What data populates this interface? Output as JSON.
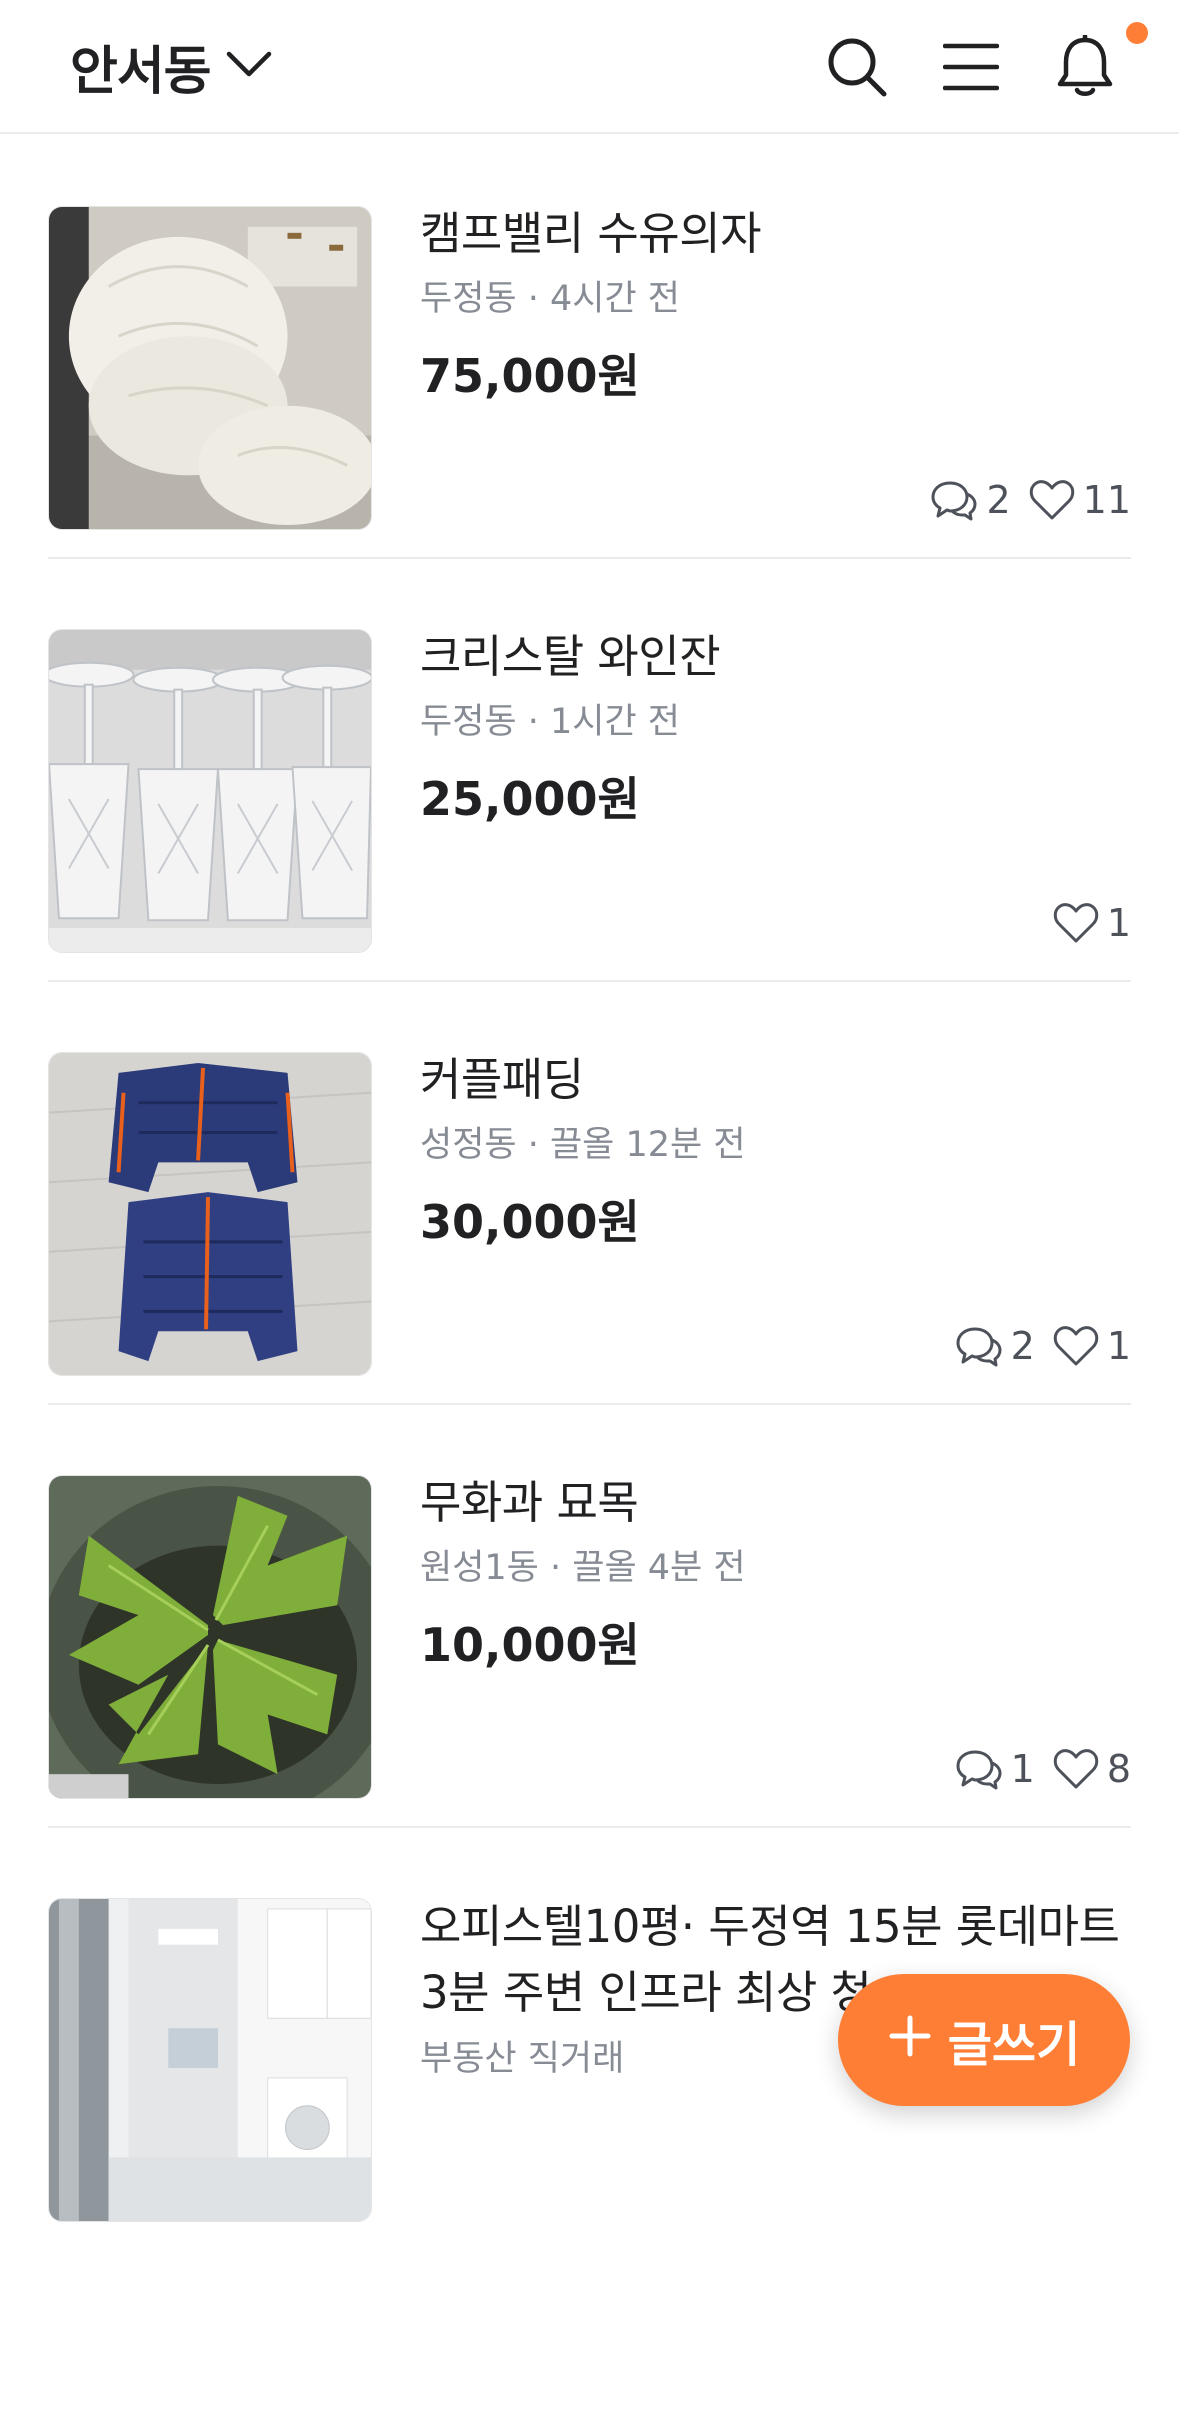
{
  "header": {
    "location": "안서동",
    "icons": [
      "search-icon",
      "menu-icon",
      "bell-icon"
    ],
    "notification_dot_color": "#ff7e36"
  },
  "items": [
    {
      "title": "캠프밸리 수유의자",
      "location": "두정동",
      "time": "4시간 전",
      "meta": "두정동 · 4시간 전",
      "price": "75,000원",
      "chats": "2",
      "likes": "11"
    },
    {
      "title": "크리스탈 와인잔",
      "location": "두정동",
      "time": "1시간 전",
      "meta": "두정동 · 1시간 전",
      "price": "25,000원",
      "likes": "1"
    },
    {
      "title": "커플패딩",
      "location": "성정동",
      "time": "끌올 12분 전",
      "meta": "성정동 · 끌올 12분 전",
      "price": "30,000원",
      "chats": "2",
      "likes": "1"
    },
    {
      "title": "무화과 묘목",
      "location": "원성1동",
      "time": "끌올 4분 전",
      "meta": "원성1동 · 끌올 4분 전",
      "price": "10,000원",
      "chats": "1",
      "likes": "8"
    },
    {
      "title": "오피스텔10평· 두정역 15분 롯데마트 3분 주변 인프라 최상 청",
      "meta": "부동산 직거래"
    }
  ],
  "fab": {
    "label": "글쓰기",
    "icon": "plus-icon",
    "color": "#ff7e36"
  }
}
